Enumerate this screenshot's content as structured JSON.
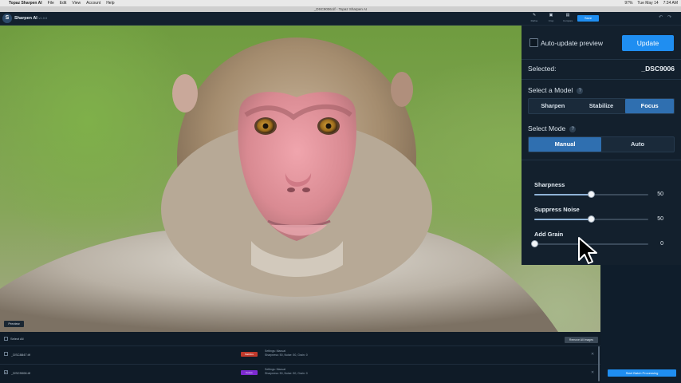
{
  "menubar": {
    "app_name": "Topaz Sharpen AI",
    "items": [
      "File",
      "Edit",
      "View",
      "Account",
      "Help"
    ],
    "status": [
      "97%",
      "Tue May 14",
      "7:34 AM"
    ]
  },
  "window": {
    "title": "_DSC9006.tif - Topaz Sharpen AI"
  },
  "header": {
    "logo_letter": "S",
    "app_name": "Sharpen AI",
    "version": "v1.0.0",
    "tools": [
      {
        "icon": "✎",
        "label": "Refine"
      },
      {
        "icon": "▣",
        "label": "Crop"
      },
      {
        "icon": "▤",
        "label": "Compare"
      }
    ],
    "save_label": "Save",
    "undo_icon": "↶",
    "redo_icon": "↷"
  },
  "preview": {
    "button_label": "Preview"
  },
  "panel": {
    "auto_update_label": "Auto-update preview",
    "update_label": "Update",
    "selected_label": "Selected:",
    "selected_value": "_DSC9006",
    "model_label": "Select a Model",
    "models": [
      "Sharpen",
      "Stabilize",
      "Focus"
    ],
    "active_model": "Focus",
    "mode_label": "Select Mode",
    "modes": [
      "Manual",
      "Auto"
    ],
    "active_mode": "Manual",
    "help_icon": "?"
  },
  "sliders": [
    {
      "label": "Sharpness",
      "value": 50,
      "max": 100
    },
    {
      "label": "Suppress Noise",
      "value": 50,
      "max": 100
    },
    {
      "label": "Add Grain",
      "value": 0,
      "max": 100
    }
  ],
  "list": {
    "select_all": "Select All",
    "remove_all": "Remove All Images",
    "rows": [
      {
        "name": "_DSC8847.tif",
        "badge": "Stabilize",
        "badge_color": "#c0392b",
        "settings_1": "Settings: Manual",
        "settings_2": "Sharpness: 50, Noise: 50, Grain: 0",
        "checked": false
      },
      {
        "name": "_DSC9006.tif",
        "badge": "Focus",
        "badge_color": "#7d2bd1",
        "settings_1": "Settings: Manual",
        "settings_2": "Sharpness: 50, Noise: 50, Grain: 0",
        "checked": true
      }
    ]
  },
  "batch_button": "Start Batch Processing",
  "colors": {
    "accent": "#1f8ef1",
    "panel_bg": "#13202d",
    "active_segment": "#2f6fb0"
  }
}
